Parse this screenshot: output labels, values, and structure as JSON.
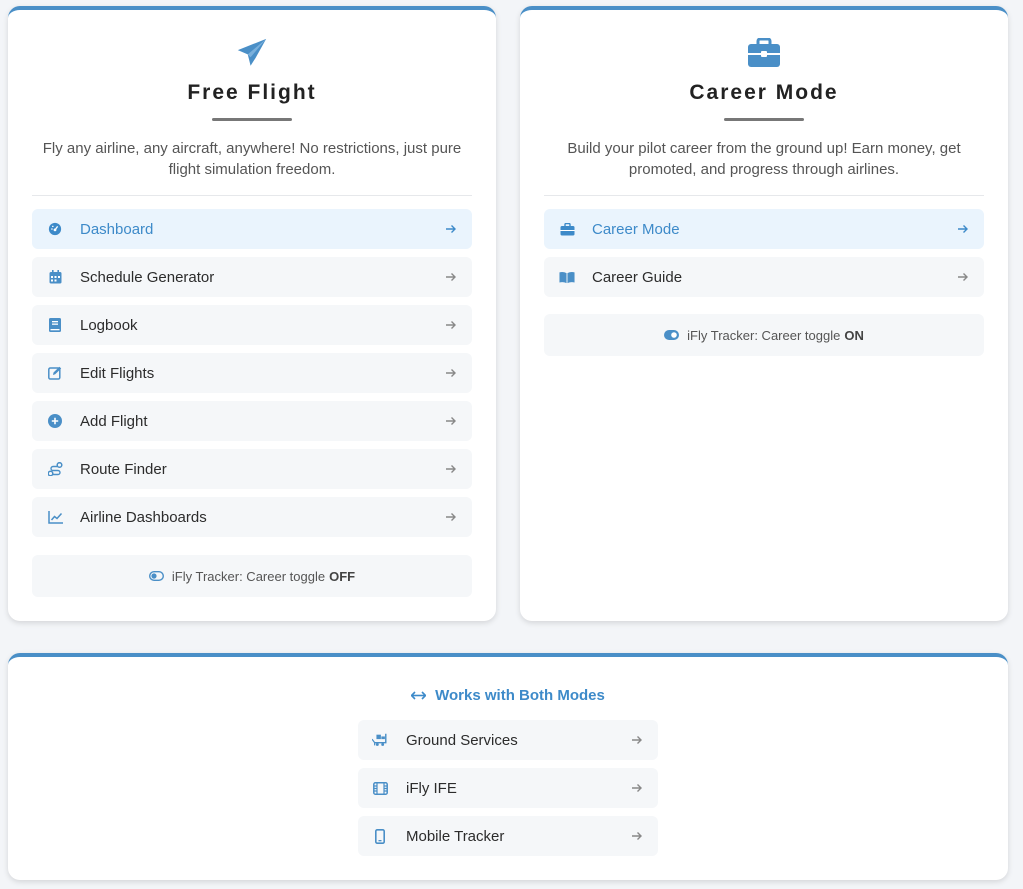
{
  "colors": {
    "accent": "#4a8fc7",
    "active_text": "#3d8ac9",
    "active_bg": "#eaf4fd"
  },
  "free_flight": {
    "icon": "paper-plane-icon",
    "title": "Free Flight",
    "description": "Fly any airline, any aircraft, anywhere! No restrictions, just pure flight simulation freedom.",
    "items": [
      {
        "label": "Dashboard",
        "icon": "gauge-icon",
        "active": true
      },
      {
        "label": "Schedule Generator",
        "icon": "calendar-icon"
      },
      {
        "label": "Logbook",
        "icon": "book-icon"
      },
      {
        "label": "Edit Flights",
        "icon": "edit-icon"
      },
      {
        "label": "Add Flight",
        "icon": "plus-circle-icon"
      },
      {
        "label": "Route Finder",
        "icon": "route-icon"
      },
      {
        "label": "Airline Dashboards",
        "icon": "chart-line-icon"
      }
    ],
    "toggle_text": "iFly Tracker: Career toggle",
    "toggle_state": "OFF"
  },
  "career_mode": {
    "icon": "briefcase-icon",
    "title": "Career Mode",
    "description": "Build your pilot career from the ground up! Earn money, get promoted, and progress through airlines.",
    "items": [
      {
        "label": "Career Mode",
        "icon": "briefcase-icon",
        "active": true
      },
      {
        "label": "Career Guide",
        "icon": "book-open-icon"
      }
    ],
    "toggle_text": "iFly Tracker: Career toggle",
    "toggle_state": "ON"
  },
  "both_modes": {
    "title": "Works with Both Modes",
    "icon": "arrows-horizontal-icon",
    "items": [
      {
        "label": "Ground Services",
        "icon": "truck-ramp-icon"
      },
      {
        "label": "iFly IFE",
        "icon": "film-icon"
      },
      {
        "label": "Mobile Tracker",
        "icon": "mobile-icon"
      }
    ]
  }
}
